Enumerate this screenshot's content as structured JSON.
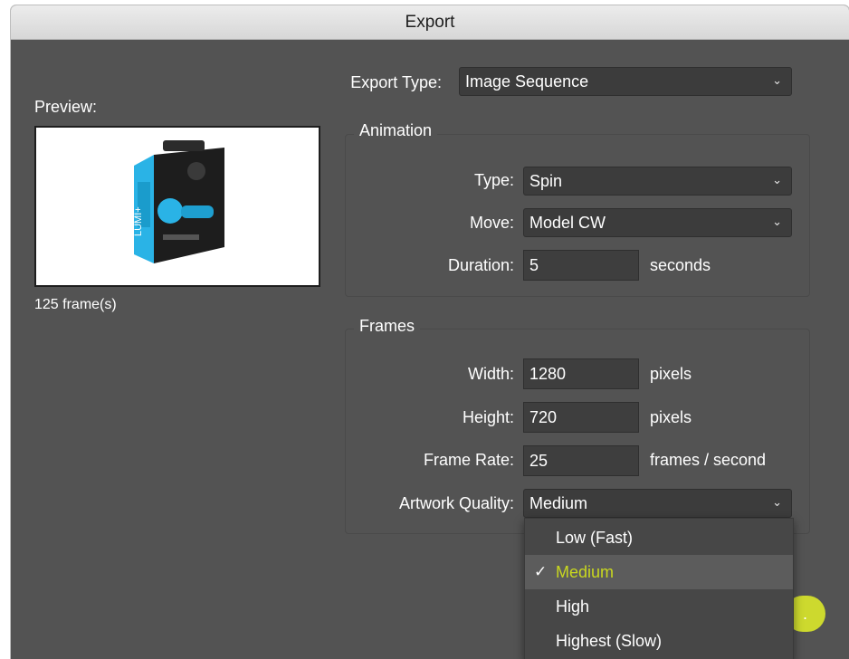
{
  "window": {
    "title": "Export"
  },
  "preview": {
    "label": "Preview:",
    "frames": "125 frame(s)",
    "product_label": "LUMI+"
  },
  "export_type": {
    "label": "Export Type:",
    "value": "Image Sequence"
  },
  "animation": {
    "title": "Animation",
    "type": {
      "label": "Type:",
      "value": "Spin"
    },
    "move": {
      "label": "Move:",
      "value": "Model CW"
    },
    "duration": {
      "label": "Duration:",
      "value": "5",
      "unit": "seconds"
    }
  },
  "frames": {
    "title": "Frames",
    "width": {
      "label": "Width:",
      "value": "1280",
      "unit": "pixels"
    },
    "height": {
      "label": "Height:",
      "value": "720",
      "unit": "pixels"
    },
    "frame_rate": {
      "label": "Frame Rate:",
      "value": "25",
      "unit": "frames / second"
    },
    "artwork_quality": {
      "label": "Artwork Quality:",
      "value": "Medium"
    }
  },
  "quality_menu": {
    "items": [
      "Low (Fast)",
      "Medium",
      "High",
      "Highest (Slow)"
    ],
    "selected": "Medium",
    "check": "✓"
  },
  "ok_button": {
    "label": "."
  },
  "colors": {
    "panel": "#535353",
    "field": "#3c3c3c",
    "accent": "#c9d81f",
    "titlebar": "#e0e0e0"
  }
}
